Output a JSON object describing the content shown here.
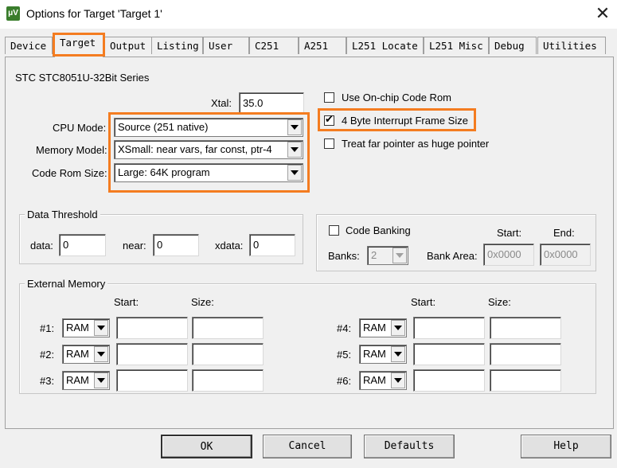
{
  "window": {
    "title": "Options for Target 'Target 1'",
    "icon_text": "μV"
  },
  "tabs": [
    {
      "label": "Device"
    },
    {
      "label": "Target"
    },
    {
      "label": "Output"
    },
    {
      "label": "Listing"
    },
    {
      "label": "User"
    },
    {
      "label": "C251"
    },
    {
      "label": "A251"
    },
    {
      "label": "L251 Locate"
    },
    {
      "label": "L251 Misc"
    },
    {
      "label": "Debug"
    },
    {
      "label": "Utilities"
    }
  ],
  "active_tab": "Target",
  "device_series": "STC STC8051U-32Bit Series",
  "xtal": {
    "label": "Xtal:",
    "value": "35.0"
  },
  "cpu_mode": {
    "label": "CPU Mode:",
    "value": "Source (251 native)"
  },
  "memory_model": {
    "label": "Memory Model:",
    "value": "XSmall: near vars, far const, ptr-4"
  },
  "code_rom_size": {
    "label": "Code Rom Size:",
    "value": "Large: 64K program"
  },
  "options": {
    "use_onchip": {
      "label": "Use On-chip Code Rom",
      "checked": false
    },
    "interrupt_frame": {
      "label": "4 Byte Interrupt Frame Size",
      "checked": true
    },
    "far_pointer": {
      "label": "Treat far pointer as huge pointer",
      "checked": false
    }
  },
  "data_threshold": {
    "title": "Data Threshold",
    "data_label": "data:",
    "data_value": "0",
    "near_label": "near:",
    "near_value": "0",
    "xdata_label": "xdata:",
    "xdata_value": "0"
  },
  "banking": {
    "checkbox_label": "Code Banking",
    "banks_label": "Banks:",
    "banks_value": "2",
    "bank_area_label": "Bank Area:",
    "start_label": "Start:",
    "end_label": "End:",
    "start_value": "0x0000",
    "end_value": "0x0000"
  },
  "external_memory": {
    "title": "External Memory",
    "start_label": "Start:",
    "size_label": "Size:",
    "rows": [
      {
        "label": "#1:",
        "type": "RAM"
      },
      {
        "label": "#2:",
        "type": "RAM"
      },
      {
        "label": "#3:",
        "type": "RAM"
      },
      {
        "label": "#4:",
        "type": "RAM"
      },
      {
        "label": "#5:",
        "type": "RAM"
      },
      {
        "label": "#6:",
        "type": "RAM"
      }
    ]
  },
  "buttons": {
    "ok": "OK",
    "cancel": "Cancel",
    "defaults": "Defaults",
    "help": "Help"
  },
  "colors": {
    "highlight": "#f47c20",
    "dialog_bg": "#f0f0f0"
  }
}
